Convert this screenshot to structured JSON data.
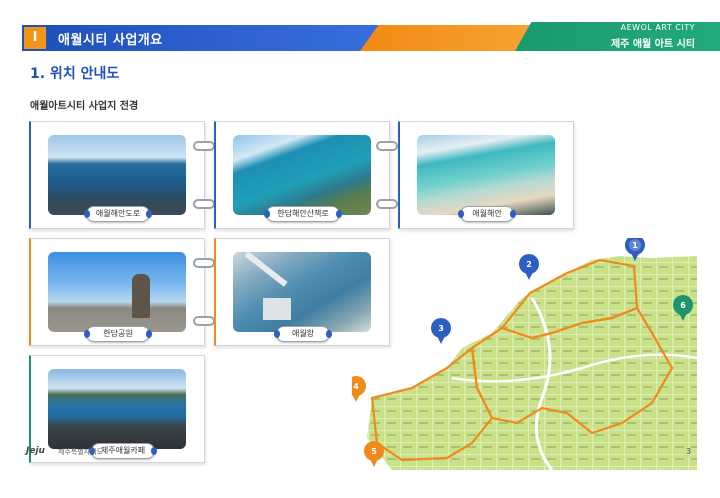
{
  "header": {
    "section_number": "I",
    "title": "애월시티 사업개요",
    "en_brand": "AEWOL ART CITY",
    "ko_brand": "제주 애월 아트 시티"
  },
  "section_title": "1. 위치 안내도",
  "subtitle": "애월아트시티 사업지 전경",
  "photos": [
    {
      "label": "애월해안도로"
    },
    {
      "label": "한담해안산책로"
    },
    {
      "label": "애월해안"
    },
    {
      "label": "한담공원"
    },
    {
      "label": "애월항"
    },
    {
      "label": "제주애월카페"
    }
  ],
  "map": {
    "pins": [
      {
        "number": "1",
        "color": "#2c5fbf"
      },
      {
        "number": "2",
        "color": "#2c5fbf"
      },
      {
        "number": "3",
        "color": "#2c5fbf"
      },
      {
        "number": "4",
        "color": "#f08a1c"
      },
      {
        "number": "5",
        "color": "#f08a1c"
      },
      {
        "number": "6",
        "color": "#20956a"
      }
    ]
  },
  "footer": {
    "logo": "Jeju",
    "text": "제주특별자치도"
  },
  "page_number": "3",
  "colors": {
    "blue": "#2c5fbf",
    "orange": "#f08a1c",
    "green": "#20956a"
  }
}
